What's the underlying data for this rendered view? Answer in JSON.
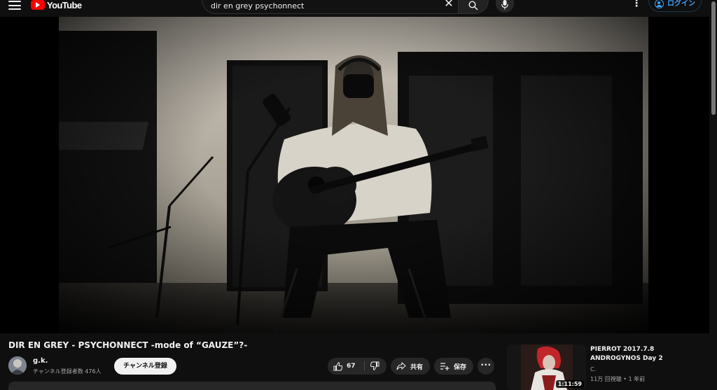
{
  "app": {
    "logo_text": "YouTube"
  },
  "search": {
    "query": "dir en grey psychonnect",
    "placeholder": ""
  },
  "header": {
    "login_label": "ログイン"
  },
  "video": {
    "title": "DIR EN GREY - PSYCHONNECT -mode of “GAUZE”?-",
    "channel_name": "g.k.",
    "subscribers": "チャンネル登録者数 476人",
    "subscribe_label": "チャンネル登録",
    "like_count": "67",
    "share_label": "共有",
    "save_label": "保存"
  },
  "recommendations": [
    {
      "title": "PIERROT 2017.7.8 ANDROGYNOS Day 2",
      "channel": "C.",
      "meta": "11万 回視聴 • 1 年前",
      "duration": "1:11:59"
    }
  ],
  "icons": {
    "menu": "menu-icon",
    "logo": "youtube-logo-icon",
    "clear": "close-icon",
    "search": "search-icon",
    "mic": "mic-icon",
    "more": "more-vert-icon",
    "user": "user-circle-icon",
    "like": "thumbs-up-icon",
    "dislike": "thumbs-down-icon",
    "share": "share-icon",
    "save": "playlist-add-icon",
    "more_actions": "more-horiz-icon"
  },
  "colors": {
    "brand_red": "#ff0000",
    "link_blue": "#3ea6ff",
    "background": "#0f0f0f"
  }
}
